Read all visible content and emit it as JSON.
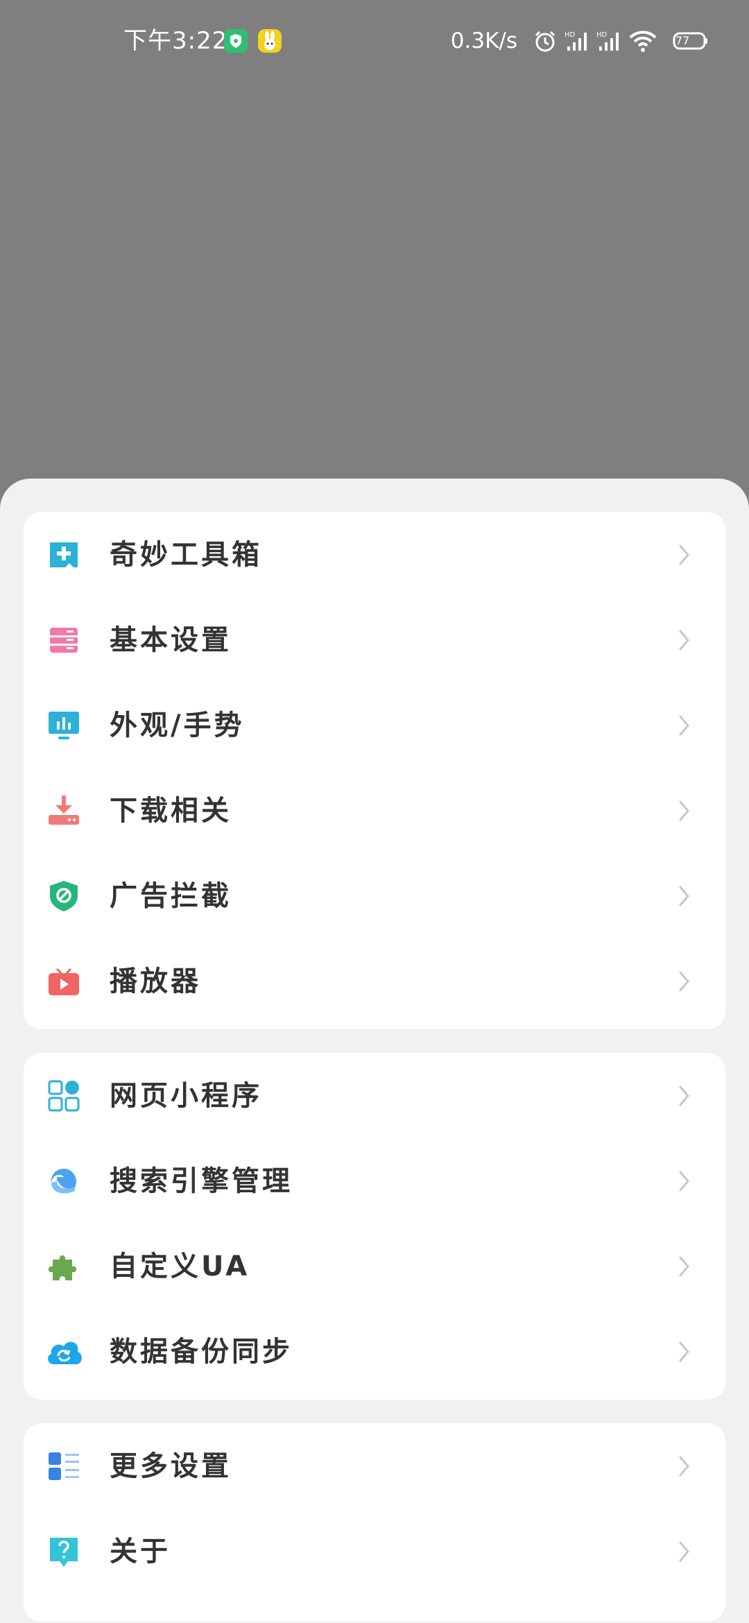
{
  "status_bar": {
    "time": "下午3:22",
    "net_speed": "0.3K/s",
    "battery": "77",
    "app_icons": [
      "shield-icon",
      "bunny-icon"
    ],
    "system_icons": [
      "alarm-icon",
      "signal-hd-icon",
      "signal-hd-icon",
      "wifi-icon",
      "battery-icon"
    ]
  },
  "menu": {
    "group1": [
      {
        "label": "奇妙工具箱",
        "icon": "toolbox-icon",
        "color": "#2bb2d6"
      },
      {
        "label": "基本设置",
        "icon": "basic-settings-icon",
        "color": "#f27aa6"
      },
      {
        "label": "外观/手势",
        "icon": "appearance-icon",
        "color": "#2bb2d6"
      },
      {
        "label": "下载相关",
        "icon": "download-icon",
        "color": "#f07a7a"
      },
      {
        "label": "广告拦截",
        "icon": "ad-block-icon",
        "color": "#25b67a"
      },
      {
        "label": "播放器",
        "icon": "player-icon",
        "color": "#f06464"
      }
    ],
    "group2": [
      {
        "label": "网页小程序",
        "icon": "mini-program-icon",
        "color": "#2bb2d6"
      },
      {
        "label": "搜索引擎管理",
        "icon": "search-engine-icon",
        "color": "#4aa3f0"
      },
      {
        "label": "自定义UA",
        "icon": "puzzle-icon",
        "color": "#6aa84f"
      },
      {
        "label": "数据备份同步",
        "icon": "cloud-sync-icon",
        "color": "#1ea7e8"
      }
    ],
    "group3": [
      {
        "label": "更多设置",
        "icon": "more-settings-icon",
        "color": "#3b82e6"
      },
      {
        "label": "关于",
        "icon": "about-icon",
        "color": "#35c3d8"
      }
    ]
  }
}
